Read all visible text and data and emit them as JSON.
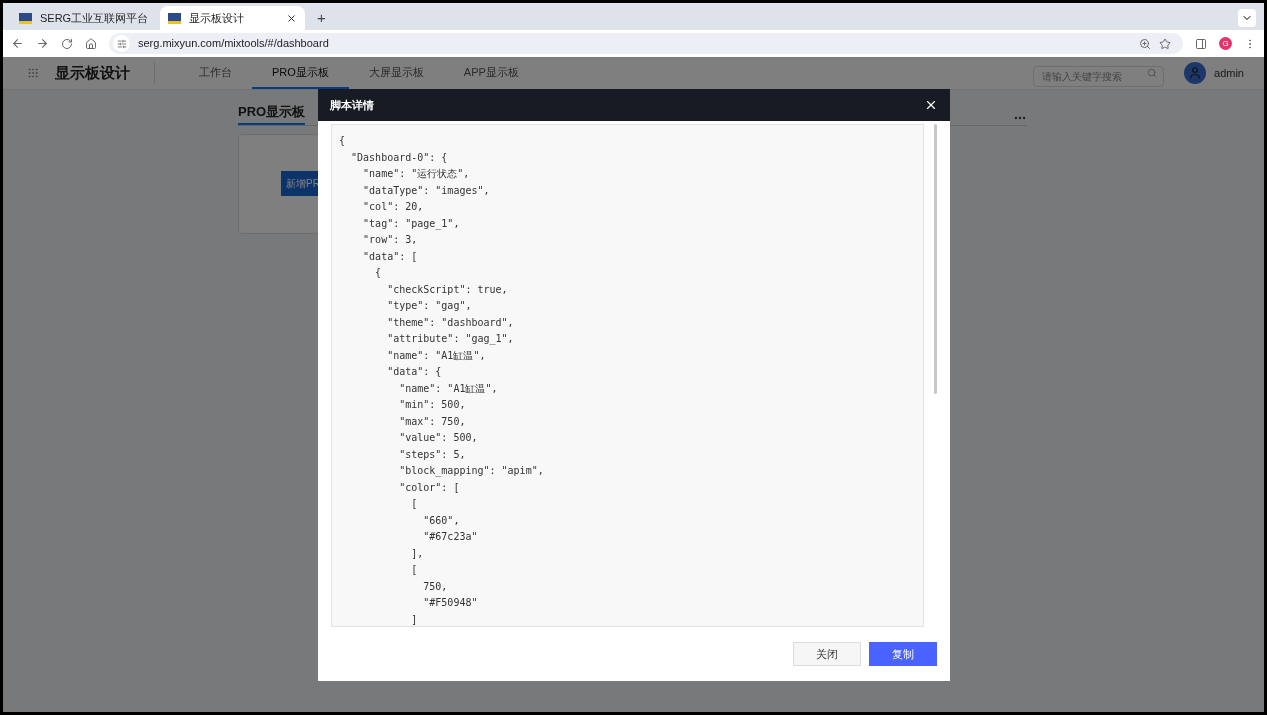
{
  "browser": {
    "tabs": [
      {
        "title": "SERG工业互联网平台",
        "selected": false
      },
      {
        "title": "显示板设计",
        "selected": true
      }
    ],
    "new_tab": "+",
    "url": "serg.mixyun.com/mixtools/#/dashboard",
    "profile_initial": "G"
  },
  "app": {
    "title": "显示板设计",
    "nav": [
      {
        "label": "工作台",
        "selected": false
      },
      {
        "label": "PRO显示板",
        "selected": true
      },
      {
        "label": "大屏显示板",
        "selected": false
      },
      {
        "label": "APP显示板",
        "selected": false
      }
    ],
    "search": {
      "placeholder": "请输入关键字搜索"
    },
    "user": "admin"
  },
  "page": {
    "section_title": "PRO显示板",
    "add_button": "新增PR"
  },
  "modal": {
    "title": "脚本详情",
    "code_lines": [
      "{",
      "  \"Dashboard-0\": {",
      "    \"name\": \"运行状态\",",
      "    \"dataType\": \"images\",",
      "    \"col\": 20,",
      "    \"tag\": \"page_1\",",
      "    \"row\": 3,",
      "    \"data\": [",
      "      {",
      "        \"checkScript\": true,",
      "        \"type\": \"gag\",",
      "        \"theme\": \"dashboard\",",
      "        \"attribute\": \"gag_1\",",
      "        \"name\": \"A1缸温\",",
      "        \"data\": {",
      "          \"name\": \"A1缸温\",",
      "          \"min\": 500,",
      "          \"max\": 750,",
      "          \"value\": 500,",
      "          \"steps\": 5,",
      "          \"block_mapping\": \"apim\",",
      "          \"color\": [",
      "            [",
      "              \"660\",",
      "              \"#67c23a\"",
      "            ],",
      "            [",
      "              750,",
      "              \"#F50948\"",
      "            ]"
    ],
    "buttons": [
      {
        "label": "关闭",
        "kind": "secondary"
      },
      {
        "label": "复制",
        "kind": "primary"
      }
    ]
  }
}
